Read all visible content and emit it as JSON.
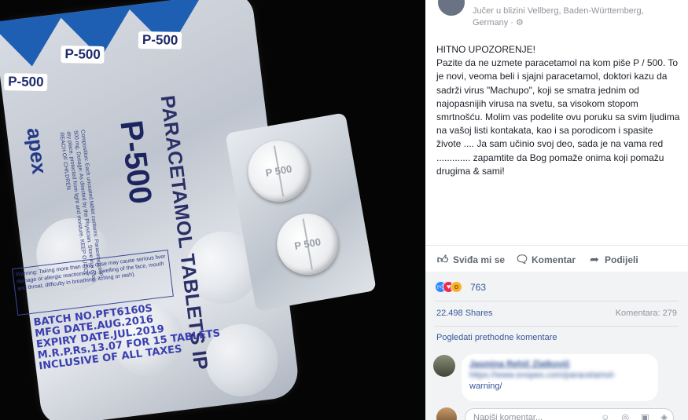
{
  "photo": {
    "tag_label": "P-500",
    "title": "PARACETAMOL TABLETS IP",
    "brand_big": "P-500",
    "tablets_word": "Tablets",
    "logo": "apex",
    "small_print": "Composition: Each uncoated tablet contains: Paracetamol IP 500 mg. Dosage: As directed by the Physician. Store in a cool dry place, protected from light and moisture. KEEP OUT OF REACH OF CHILDREN",
    "warning": "Warning: Taking more than daily dose may cause serious liver damage or allergic reactions (e.g. swelling of the face, mouth and throat, difficulty in breathing, itching or rash).",
    "batch_lines": [
      "BATCH NO.PFT6160S",
      "MFG DATE.AUG.2016",
      "EXPIRY DATE.JUL.2019",
      "M.R.P.Rs.13.07 FOR 15 TABLETS",
      "INCLUSIVE OF ALL TAXES"
    ],
    "tablet_text_1": "P 500",
    "tablet_text_2": "P 500"
  },
  "post": {
    "meta_line1": "Jučer u blizini Vellberg, Baden-Württemberg,",
    "meta_line2": "Germany · ⚙",
    "heading": "HITNO UPOZORENJE!",
    "body": "Pazite da ne uzmete paracetamol na kom piše P / 500. To je novi, veoma beli i sjajni paracetamol, doktori kazu da sadrži virus \"Machupo\", koji se smatra jednim od najopasnijih virusa na svetu, sa visokom stopom smrtnošću. Molim vas podelite ovu poruku sa svim ljudima na vašoj listi kontakata, kao i sa porodicom i spasite živote .... Ja sam učinio svoj deo, sada je na vama red ............. zapamtite da Bog pomaže onima koji pomažu drugima & sami!"
  },
  "actions": {
    "like": "Sviđa mi se",
    "comment": "Komentar",
    "share": "Podijeli"
  },
  "stats": {
    "reactions": "763",
    "shares": "22.498 Shares",
    "comments": "Komentara: 279",
    "view_previous": "Pogledati prethodne komentare"
  },
  "comment": {
    "author": "Jasmina Rehič Zlatkovič",
    "link_prefix": "https://www.snopes.com/paracetamol-",
    "link_suffix": "warning/"
  },
  "reply": {
    "placeholder": "Napiši komentar...",
    "icons": "☺ ◎ ▣ ◈"
  },
  "colors": {
    "fb_blue": "#365899",
    "text_dark": "#1d2129",
    "text_grey": "#90949c"
  }
}
